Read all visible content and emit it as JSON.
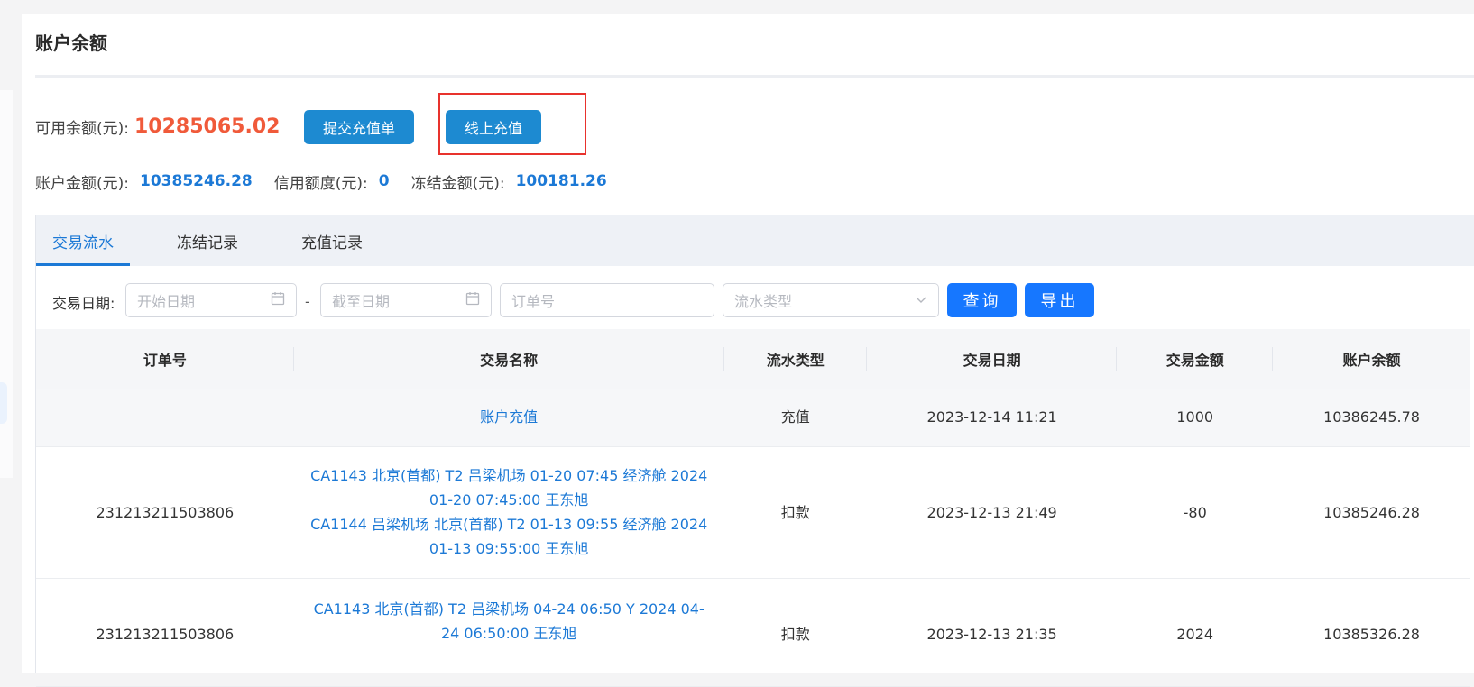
{
  "page": {
    "title": "账户余额"
  },
  "balance": {
    "available_label": "可用余额(元):",
    "available_amount": "10285065.02",
    "submit_button": "提交充值单",
    "online_button": "线上充值",
    "account_label": "账户金额(元):",
    "account_amount": "10385246.28",
    "credit_label": "信用额度(元):",
    "credit_amount": "0",
    "frozen_label": "冻结金额(元):",
    "frozen_amount": "100181.26"
  },
  "tabs": [
    {
      "label": "交易流水",
      "active": true
    },
    {
      "label": "冻结记录",
      "active": false
    },
    {
      "label": "充值记录",
      "active": false
    }
  ],
  "filters": {
    "date_label": "交易日期:",
    "start_placeholder": "开始日期",
    "dash": "-",
    "end_placeholder": "截至日期",
    "order_placeholder": "订单号",
    "type_placeholder": "流水类型",
    "query_button": "查询",
    "export_button": "导出"
  },
  "table": {
    "headers": [
      "订单号",
      "交易名称",
      "流水类型",
      "交易日期",
      "交易金额",
      "账户余额"
    ],
    "rows": [
      {
        "order": "",
        "name_lines": [
          "账户充值"
        ],
        "type": "充值",
        "date": "2023-12-14 11:21",
        "amount": "1000",
        "balance": "10386245.78"
      },
      {
        "order": "231213211503806",
        "name_lines": [
          "CA1143 北京(首都) T2 吕梁机场 01-20 07:45 经济舱 2024",
          "01-20 07:45:00 王东旭",
          "CA1144 吕梁机场 北京(首都) T2 01-13 09:55 经济舱 2024",
          "01-13 09:55:00 王东旭"
        ],
        "type": "扣款",
        "date": "2023-12-13 21:49",
        "amount": "-80",
        "balance": "10385246.28"
      },
      {
        "order": "231213211503806",
        "name_lines": [
          "CA1143 北京(首都) T2 吕梁机场 04-24 06:50 Y 2024 04-",
          "24 06:50:00 王东旭"
        ],
        "type": "扣款",
        "date": "2023-12-13 21:35",
        "amount": "2024",
        "balance": "10385326.28"
      }
    ]
  },
  "colors": {
    "accent": "#1c79d6",
    "available_amount": "#f05a3a",
    "primary_button": "#1d8ad1",
    "query_button": "#1677ff",
    "highlight": "#e8322d"
  }
}
